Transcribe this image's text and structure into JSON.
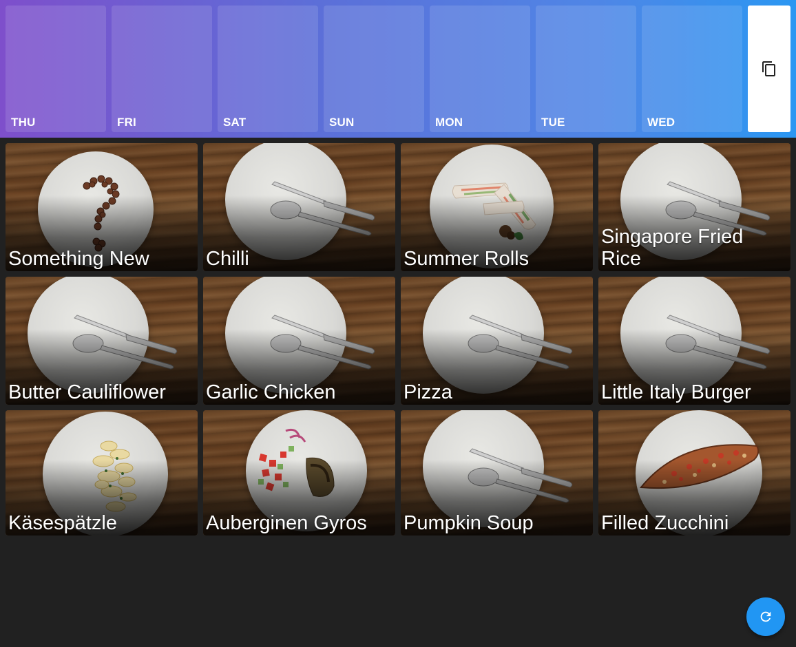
{
  "week": {
    "days": [
      {
        "label": "THU"
      },
      {
        "label": "FRI"
      },
      {
        "label": "SAT"
      },
      {
        "label": "SUN"
      },
      {
        "label": "MON"
      },
      {
        "label": "TUE"
      },
      {
        "label": "WED"
      }
    ],
    "copy_icon": "copy-icon"
  },
  "recipes": [
    {
      "title": "Something New",
      "image": "question-mark-beans"
    },
    {
      "title": "Chilli",
      "image": "empty-plate-cutlery"
    },
    {
      "title": "Summer Rolls",
      "image": "summer-rolls-plate"
    },
    {
      "title": "Singapore Fried Rice",
      "image": "empty-plate-cutlery"
    },
    {
      "title": "Butter Cauliflower",
      "image": "empty-plate-cutlery"
    },
    {
      "title": "Garlic Chicken",
      "image": "empty-plate-cutlery"
    },
    {
      "title": "Pizza",
      "image": "empty-plate-cutlery"
    },
    {
      "title": "Little Italy Burger",
      "image": "empty-plate-cutlery"
    },
    {
      "title": "Käsespätzle",
      "image": "kaesespaetzle-plate"
    },
    {
      "title": "Auberginen Gyros",
      "image": "gyros-salad-plate"
    },
    {
      "title": "Pumpkin Soup",
      "image": "empty-plate-cutlery"
    },
    {
      "title": "Filled Zucchini",
      "image": "filled-zucchini-plate"
    }
  ],
  "fab": {
    "icon": "refresh-icon"
  },
  "colors": {
    "background": "#212121",
    "header_gradient_start": "#7e4fcb",
    "header_gradient_end": "#2b97f2",
    "fab": "#2196f3"
  }
}
